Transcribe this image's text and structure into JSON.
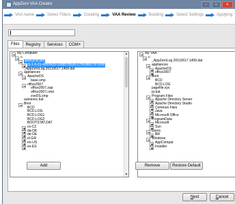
{
  "window": {
    "title": "AppZero VAA Creator",
    "controls": {
      "minimize": "–",
      "maximize": "□",
      "close": "✕"
    }
  },
  "wizard": {
    "steps": [
      {
        "label": "VAA name",
        "active": false
      },
      {
        "label": "Select Filters",
        "active": false
      },
      {
        "label": "Creating",
        "active": false
      },
      {
        "label": "VAA Review",
        "active": true
      },
      {
        "label": "Building",
        "active": false
      },
      {
        "label": "Select Settings",
        "active": false
      },
      {
        "label": "Applying",
        "active": false
      }
    ]
  },
  "tabs": [
    {
      "label": "Files",
      "active": true
    },
    {
      "label": "Registry",
      "active": false
    },
    {
      "label": "Services",
      "active": false
    },
    {
      "label": "COM+",
      "active": false
    }
  ],
  "left_tree": [
    {
      "text": "My Computer",
      "depth": 0,
      "expander": "minus"
    },
    {
      "text": "c:",
      "depth": 1,
      "expander": "minus"
    },
    {
      "text": "$Recycle.Bin",
      "depth": 2,
      "expander": "minus",
      "selected": true
    },
    {
      "text": "S-1-5-21-4053435-1068578536-2706388279-1000",
      "depth": 3,
      "expander": "plus",
      "selected": true
    },
    {
      "text": "_AppZeroLog.20110617.1409.dat",
      "depth": 2,
      "expander": "none"
    },
    {
      "text": "appliances",
      "depth": 2,
      "expander": "minus"
    },
    {
      "text": "ApacheDS",
      "depth": 3,
      "expander": "minus"
    },
    {
      "text": "base.xmp",
      "depth": 4,
      "expander": "none"
    },
    {
      "text": "office2007",
      "depth": 3,
      "expander": "minus"
    },
    {
      "text": "office2007.zap",
      "depth": 4,
      "expander": "none"
    },
    {
      "text": "office2007.cmd",
      "depth": 4,
      "expander": "none"
    },
    {
      "text": "zveDS.xmp",
      "depth": 4,
      "expander": "none"
    },
    {
      "text": "autoexec.bat",
      "depth": 2,
      "expander": "none"
    },
    {
      "text": "Boot",
      "depth": 2,
      "expander": "minus"
    },
    {
      "text": "BCD",
      "depth": 3,
      "expander": "none"
    },
    {
      "text": "BCD.LOG",
      "depth": 3,
      "expander": "none"
    },
    {
      "text": "BCD.LOG1",
      "depth": 3,
      "expander": "none"
    },
    {
      "text": "BCD.LOG2",
      "depth": 3,
      "expander": "none"
    },
    {
      "text": "BOOTSTAT.DAT",
      "depth": 3,
      "expander": "none"
    },
    {
      "text": "cs-CZ",
      "depth": 3,
      "expander": "plus"
    },
    {
      "text": "da-DK",
      "depth": 3,
      "expander": "plus"
    },
    {
      "text": "de-DE",
      "depth": 3,
      "expander": "plus"
    },
    {
      "text": "el-GR",
      "depth": 3,
      "expander": "plus"
    },
    {
      "text": "en-US",
      "depth": 3,
      "expander": "plus"
    },
    {
      "text": "es-ES",
      "depth": 3,
      "expander": "plus"
    }
  ],
  "right_tree": [
    {
      "text": "My VAA",
      "depth": 0,
      "expander": "minus"
    },
    {
      "text": "c:",
      "depth": 1,
      "expander": "minus"
    },
    {
      "text": "_AppZeroLog.20110617.1409.dat",
      "depth": 2,
      "expander": "none"
    },
    {
      "text": "appliances",
      "depth": 2,
      "expander": "minus"
    },
    {
      "text": "ApacheDS",
      "depth": 3,
      "expander": "plus"
    },
    {
      "text": "office2007",
      "depth": 3,
      "expander": "plus"
    },
    {
      "text": "Boot",
      "depth": 2,
      "expander": "minus"
    },
    {
      "text": "BCD",
      "depth": 3,
      "expander": "none"
    },
    {
      "text": "BCD.LOG",
      "depth": 3,
      "expander": "none"
    },
    {
      "text": "pagefile.sys",
      "depth": 2,
      "expander": "none"
    },
    {
      "text": "pr.bat",
      "depth": 2,
      "expander": "none"
    },
    {
      "text": "Program Files",
      "depth": 2,
      "expander": "minus"
    },
    {
      "text": "Apache Directory Server",
      "depth": 3,
      "expander": "plus"
    },
    {
      "text": "Apache Directory Studio",
      "depth": 3,
      "expander": "plus"
    },
    {
      "text": "Common Files",
      "depth": 3,
      "expander": "plus"
    },
    {
      "text": "Java",
      "depth": 3,
      "expander": "plus"
    },
    {
      "text": "Microsoft Office",
      "depth": 3,
      "expander": "plus"
    },
    {
      "text": "ProgramData",
      "depth": 2,
      "expander": "minus"
    },
    {
      "text": "Microsoft",
      "depth": 3,
      "expander": "plus"
    },
    {
      "text": "Sun",
      "depth": 3,
      "expander": "plus"
    },
    {
      "text": "Users",
      "depth": 2,
      "expander": "minus"
    },
    {
      "text": "Bill",
      "depth": 3,
      "expander": "plus"
    },
    {
      "text": "Windows",
      "depth": 2,
      "expander": "minus"
    },
    {
      "text": "AppCompat",
      "depth": 3,
      "expander": "plus"
    },
    {
      "text": "Installer",
      "depth": 3,
      "expander": "plus"
    }
  ],
  "buttons": {
    "add": "Add",
    "remove": "Remove",
    "restore_default": "Restore Default",
    "next": "Next",
    "next_mnemonic": "N",
    "next_rest": "ext",
    "cancel": "Cancel",
    "cancel_mnemonic": "C",
    "cancel_rest": "ancel"
  },
  "icons": {
    "step_separator": "arrow-right-icon",
    "expand": "plus-box-icon",
    "collapse": "minus-box-icon"
  },
  "colors": {
    "accent": "#2a78c9",
    "selection": "#3399ff",
    "titlebar": "#6f84a0"
  }
}
